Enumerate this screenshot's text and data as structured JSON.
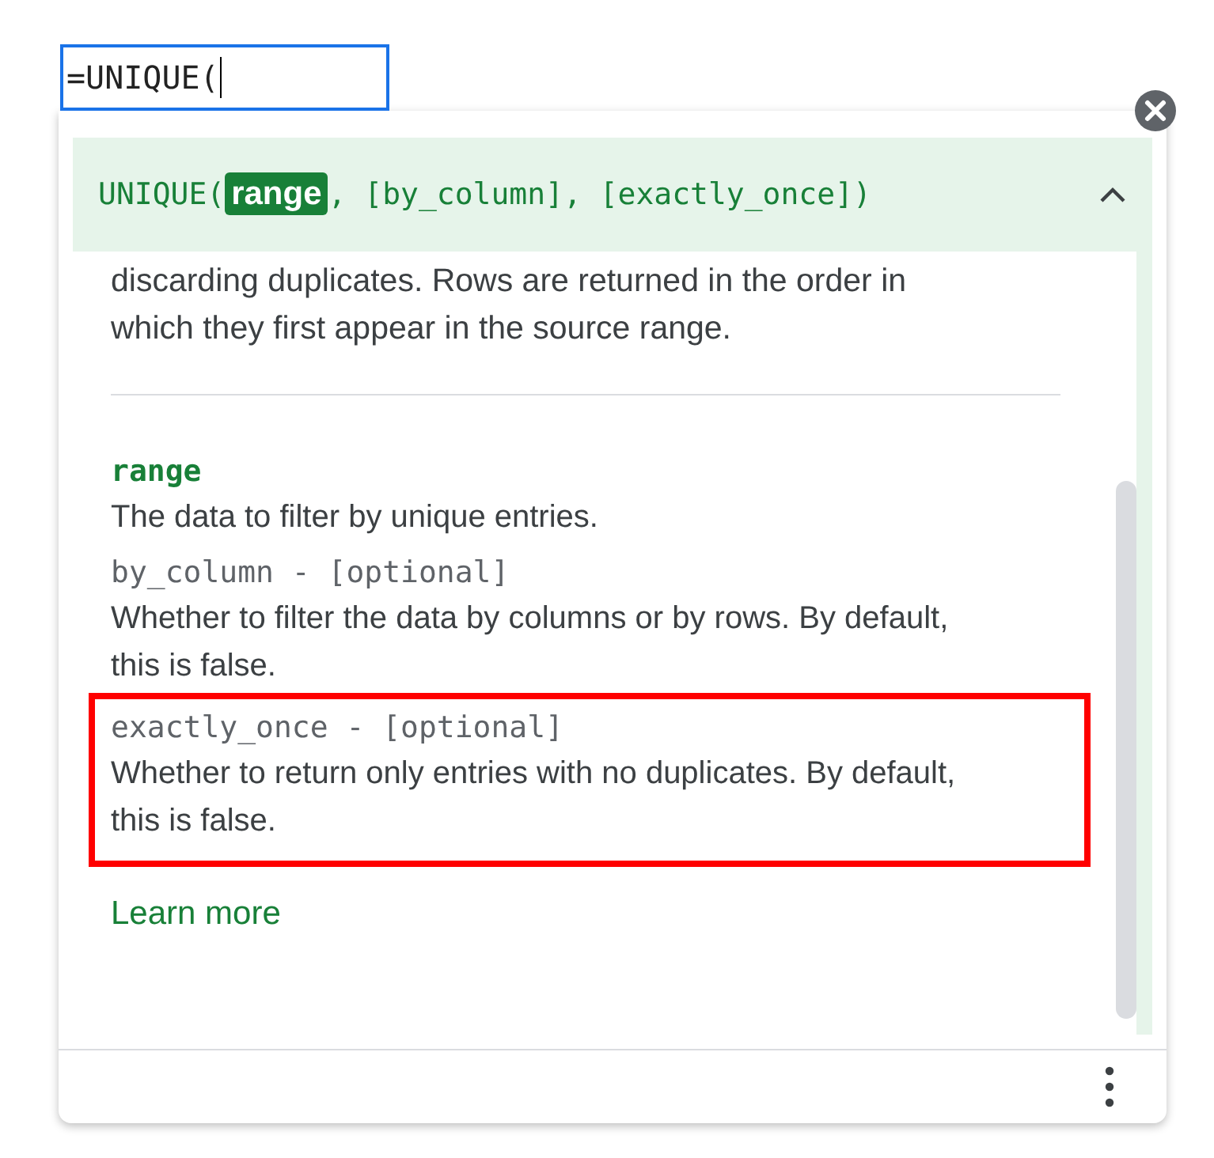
{
  "formula_cell": {
    "value": "=UNIQUE("
  },
  "popup": {
    "signature": {
      "before": "UNIQUE(",
      "active_argument": "range",
      "after": ", [by_column], [exactly_once])"
    },
    "expanded": true,
    "description": "discarding duplicates. Rows are returned in the order in which they first appear in the source range.",
    "parameters": [
      {
        "name": "range",
        "active": true,
        "highlighted": false,
        "description": "The data to filter by unique entries."
      },
      {
        "name": "by_column - [optional]",
        "active": false,
        "highlighted": false,
        "description": "Whether to filter the data by columns or by rows. By default, this is false."
      },
      {
        "name": "exactly_once - [optional]",
        "active": false,
        "highlighted": true,
        "description": "Whether to return only entries with no duplicates. By default, this is false."
      }
    ],
    "learn_more": "Learn more"
  }
}
